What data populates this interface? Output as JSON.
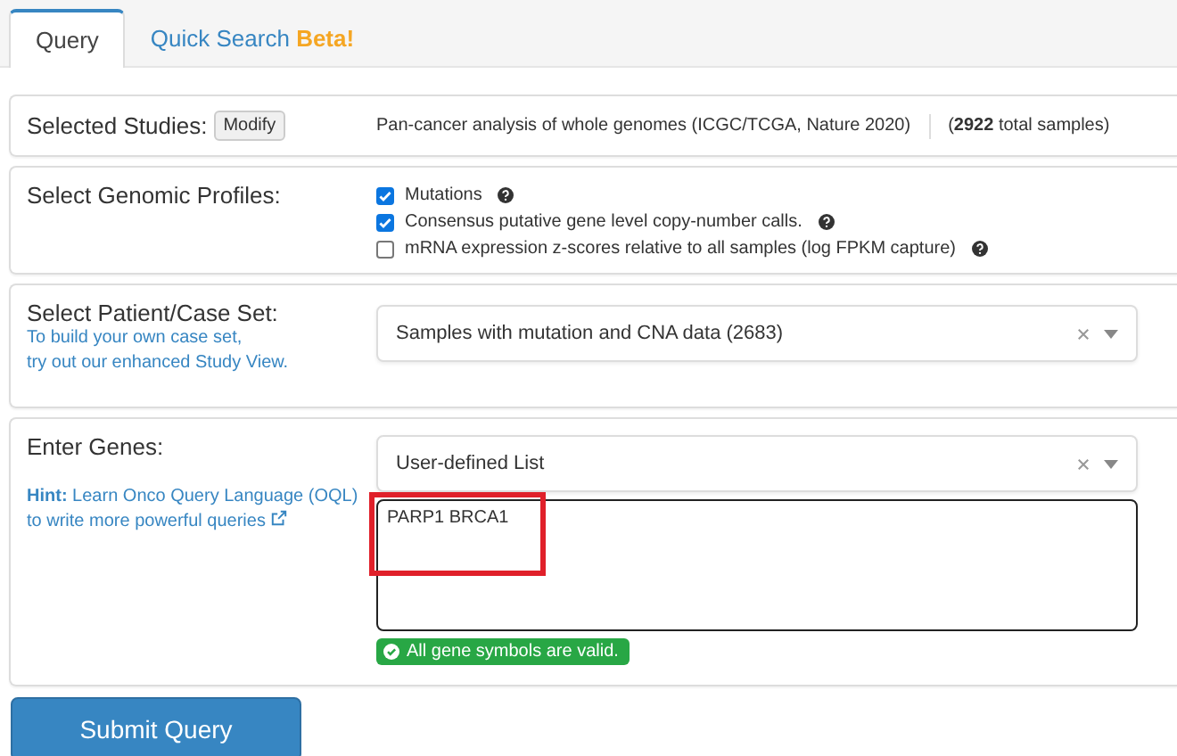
{
  "tabs": [
    {
      "label": "Query",
      "selected": true
    },
    {
      "label": "Quick Search **Beta!**",
      "selected": false
    }
  ],
  "studies": {
    "label": "Selected Studies:",
    "button": "Modify",
    "name": "Pan-cancer analysis of whole genomes (ICGC/TCGA, Nature 2020)",
    "count": "(**2922** total samples)"
  },
  "profiles": {
    "label": "Select Genomic Profiles:",
    "items": [
      {
        "label": "Mutations",
        "checked": true
      },
      {
        "label": "Consensus putative gene level copy-number calls.",
        "checked": true
      },
      {
        "label": "mRNA expression z-scores relative to all samples (log FPKM capture)",
        "checked": false
      }
    ]
  },
  "case_set": {
    "label": "Select Patient/Case Set:",
    "hint_lines": [
      "To build your own case set,",
      "try out our enhanced Study View."
    ],
    "value": "Samples with mutation and CNA data (2683)"
  },
  "genes": {
    "label": "Enter Genes:",
    "hint": "**Hint:** Learn Onco Query Language (OQL) to write more powerful queries",
    "list_value": "User-defined List",
    "value": "PARP1 BRCA1",
    "validation": "All gene symbols are valid.",
    "highlighted": true
  },
  "submit": "Submit Query"
}
